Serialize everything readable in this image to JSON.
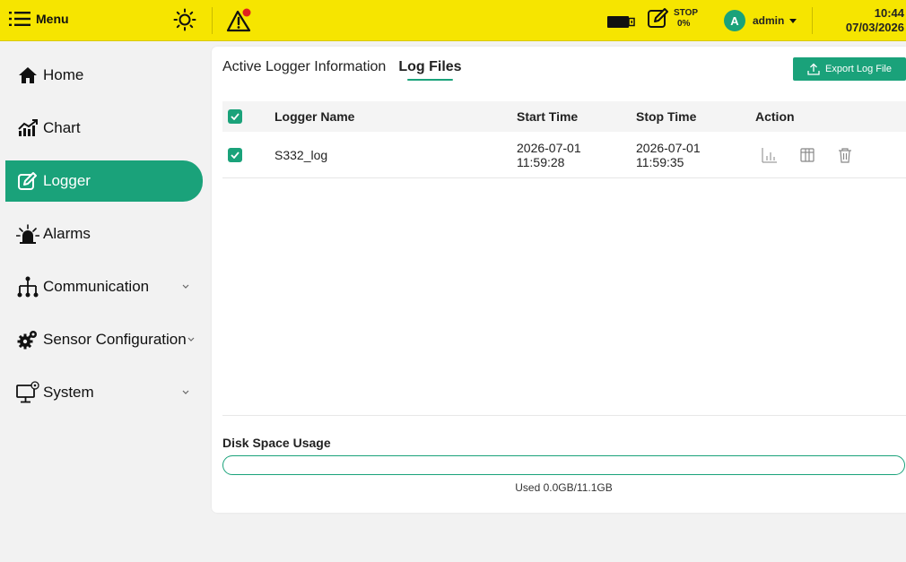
{
  "topbar": {
    "menu_label": "Menu",
    "logger_state": "STOP",
    "logger_percent": "0%",
    "user_initial": "A",
    "username": "admin",
    "time": "10:44",
    "date": "07/03/2026",
    "accent": "#f6e500",
    "alert_dot_color": "#e02020"
  },
  "sidebar": {
    "items": [
      {
        "label": "Home",
        "icon": "home-icon"
      },
      {
        "label": "Chart",
        "icon": "chart-icon"
      },
      {
        "label": "Logger",
        "icon": "logger-edit-icon",
        "active": true
      },
      {
        "label": "Alarms",
        "icon": "alarm-icon"
      },
      {
        "label": "Communication",
        "icon": "network-icon"
      },
      {
        "label": "Sensor Configuration",
        "icon": "gear-icon"
      },
      {
        "label": "System",
        "icon": "monitor-icon"
      }
    ]
  },
  "main": {
    "tabs": [
      "Active Logger Information",
      "Log Files"
    ],
    "active_tab": 1,
    "export_label": "Export Log File",
    "table": {
      "headers": [
        "Logger Name",
        "Start Time",
        "Stop Time",
        "Action"
      ],
      "rows": [
        {
          "name": "S332_log",
          "start_date": "2026-07-01",
          "start_time": "11:59:28",
          "stop_date": "2026-07-01",
          "stop_time": "11:59:35",
          "checked": true
        }
      ]
    },
    "disk": {
      "title": "Disk Space Usage",
      "usage_text": "Used 0.0GB/11.1GB",
      "used_fraction": 0.0
    }
  },
  "colors": {
    "primary": "#1aa27a"
  }
}
